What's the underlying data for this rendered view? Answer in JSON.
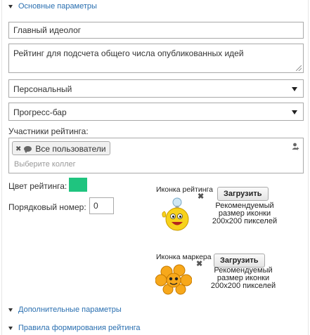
{
  "sections": {
    "basic": "Основные параметры",
    "additional": "Дополнительные параметры",
    "rules": "Правила формирования рейтинга"
  },
  "form": {
    "title_value": "Главный идеолог",
    "description_value": "Рейтинг для подсчета общего числа опубликованных идей",
    "type_select": "Персональный",
    "display_select": "Прогресс-бар",
    "members_label": "Участники рейтинга:",
    "members_chip": "Все пользователи",
    "members_placeholder": "Выберите коллег",
    "color_label": "Цвет рейтинга:",
    "color_value": "#1fc47f",
    "order_label": "Порядковый номер:",
    "order_value": "0"
  },
  "rating_icon": {
    "label": "Иконка рейтинга",
    "upload_label": "Загрузить",
    "hint": "Рекомендуемый размер иконки 200x200 пикселей",
    "image": "smiley-lightbulb-icon"
  },
  "marker_icon": {
    "label": "Иконка маркера",
    "upload_label": "Загрузить",
    "hint": "Рекомендуемый размер иконки 200x200 пикселей",
    "image": "orange-flower-icon"
  }
}
